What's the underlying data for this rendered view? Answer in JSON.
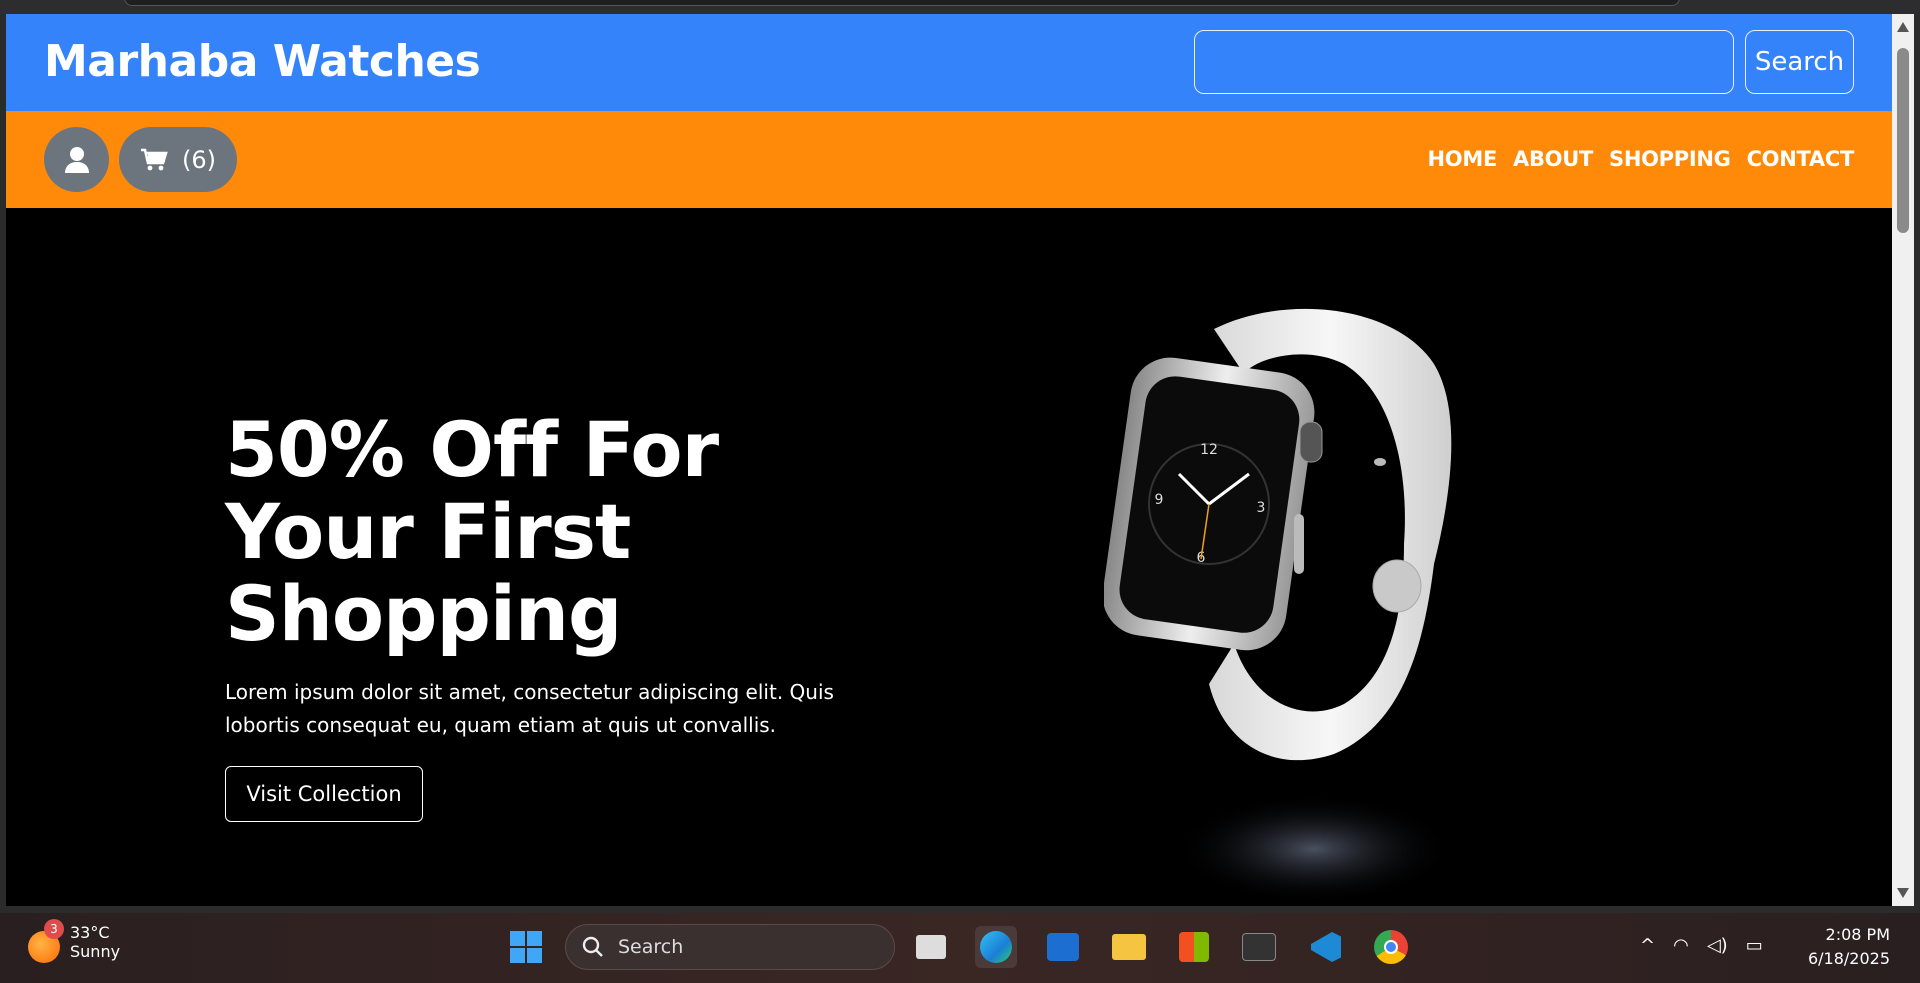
{
  "site": {
    "brand": "Marhaba Watches",
    "search": {
      "placeholder": "",
      "button_label": "Search"
    },
    "cart": {
      "count_label": "(6)"
    },
    "menu": [
      "HOME",
      "ABOUT",
      "SHOPPING",
      "CONTACT"
    ],
    "hero": {
      "title_line1": "50% Off For",
      "title_line2": "Your First",
      "title_line3": "Shopping",
      "text": "Lorem ipsum dolor sit amet, consectetur adipiscing elit. Quis lobortis consequat eu, quam etiam at quis ut convallis.",
      "button_label": "Visit Collection"
    },
    "colors": {
      "header": "#3483fb",
      "nav": "#ff8a0a",
      "hero_bg": "#000000",
      "pill": "#6c757d"
    }
  },
  "taskbar": {
    "weather": {
      "badge": "3",
      "temp": "33°C",
      "condition": "Sunny"
    },
    "search_label": "Search",
    "clock": {
      "time": "2:08 PM",
      "date": "6/18/2025"
    }
  }
}
